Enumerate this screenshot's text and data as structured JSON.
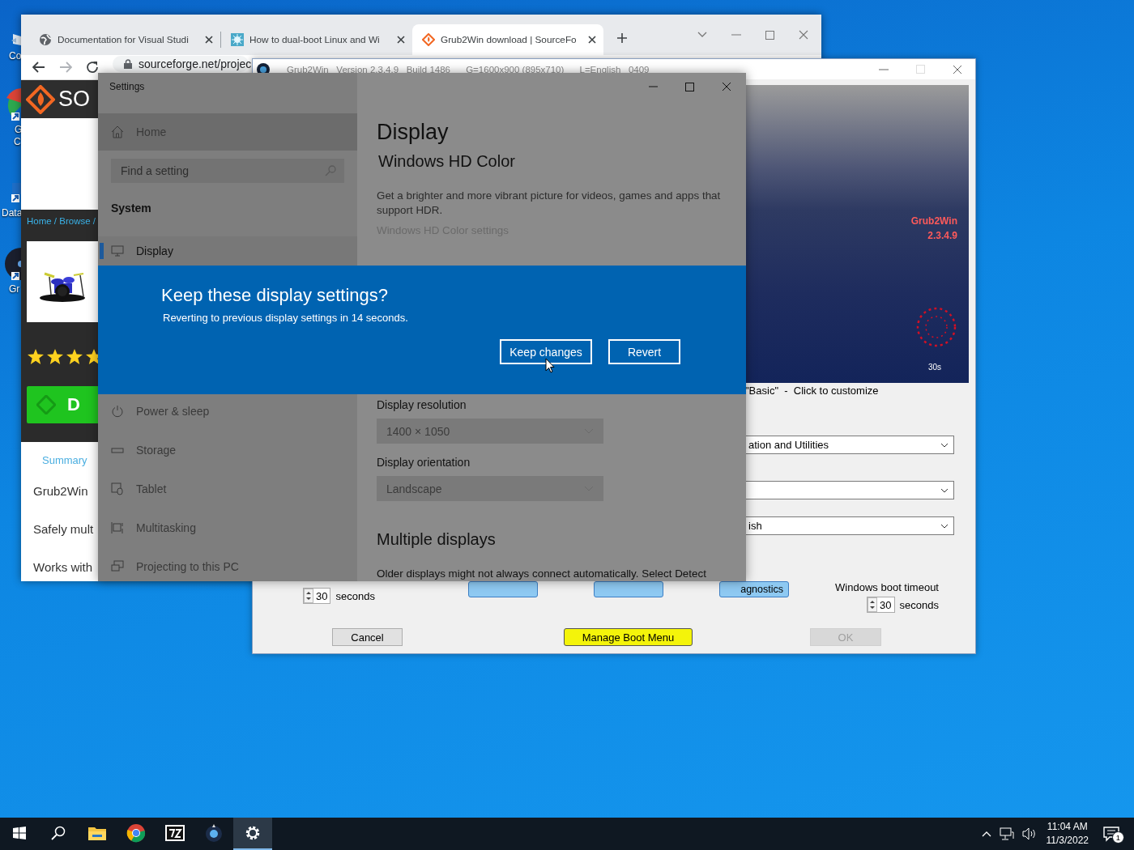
{
  "desktop_icons": [
    {
      "lines": [
        "Co"
      ]
    },
    {
      "lines": [
        "G",
        "C"
      ]
    },
    {
      "lines": [
        "Data"
      ]
    },
    {
      "lines": [
        "Gr"
      ]
    }
  ],
  "browser": {
    "tabs": [
      {
        "title": "Documentation for Visual Studi",
        "selected": false
      },
      {
        "title": "How to dual-boot Linux and Wi",
        "selected": false
      },
      {
        "title": "Grub2Win download | SourceFo",
        "selected": true
      }
    ],
    "address": "sourceforge.net/projec",
    "site": {
      "logo": "SO",
      "breadcrumb": "Home / Browse /",
      "stars": 4,
      "download": "D",
      "nav_tab": "Summary",
      "lines": [
        "Grub2Win",
        "Safely mult",
        "Works with"
      ]
    }
  },
  "grub": {
    "title": "Grub2Win   Version 2.3.4.9   Build 1486      G=1600x900 (895x710)      L=English   0409",
    "preview": {
      "lines": [
        "Grub2Win",
        "2.3.4.9"
      ],
      "countdown": "30s"
    },
    "theme_note": "\"Basic\"  -  Click to customize",
    "dropdowns": [
      {
        "kind": "text",
        "value": "ation and Utilities"
      },
      {
        "kind": "blank"
      },
      {
        "kind": "text",
        "value": "ish"
      }
    ],
    "tool_buttons": [
      {
        "kind": "blank"
      },
      {
        "kind": "blank"
      },
      {
        "kind": "text",
        "label": "agnostics"
      }
    ],
    "grub_timeout": {
      "value": "30",
      "unit": "seconds"
    },
    "windows_timeout": {
      "label": "Windows boot timeout",
      "value": "30",
      "unit": "seconds"
    },
    "buttons": [
      {
        "label": "Cancel",
        "kind": "plain",
        "disabled": false
      },
      {
        "label": "Manage Boot Menu",
        "kind": "accent",
        "disabled": false
      },
      {
        "label": "OK",
        "kind": "plain",
        "disabled": true
      }
    ]
  },
  "settings": {
    "title": "Settings",
    "home": "Home",
    "search": {
      "placeholder": "Find a setting"
    },
    "section": "System",
    "nav": [
      {
        "label": "Display",
        "selected": true
      },
      {
        "label": "Power & sleep",
        "selected": false
      },
      {
        "label": "Storage",
        "selected": false
      },
      {
        "label": "Tablet",
        "selected": false
      },
      {
        "label": "Multitasking",
        "selected": false
      },
      {
        "label": "Projecting to this PC",
        "selected": false
      }
    ],
    "page": {
      "title": "Display",
      "hdr_heading": "Windows HD Color",
      "hdr_text": "Get a brighter and more vibrant picture for videos, games and apps that support HDR.",
      "hdr_link": "Windows HD Color settings",
      "resolution": {
        "label": "Display resolution",
        "value": "1400 × 1050",
        "disabled": true
      },
      "orientation": {
        "label": "Display orientation",
        "value": "Landscape",
        "disabled": true
      },
      "multiple_heading": "Multiple displays",
      "multiple_text": "Older displays might not always connect automatically. Select Detect"
    },
    "dialog": {
      "title": "Keep these display settings?",
      "message": "Reverting to previous display settings in 14 seconds.",
      "buttons": [
        {
          "label": "Keep changes"
        },
        {
          "label": "Revert"
        }
      ]
    }
  },
  "taskbar": {
    "apps": [
      {
        "active": false
      },
      {
        "active": false
      },
      {
        "active": false
      },
      {
        "active": false
      },
      {
        "active": false
      },
      {
        "active": false
      },
      {
        "active": true
      }
    ],
    "time": "11:04 AM",
    "date": "11/3/2022",
    "notifications": "1"
  }
}
